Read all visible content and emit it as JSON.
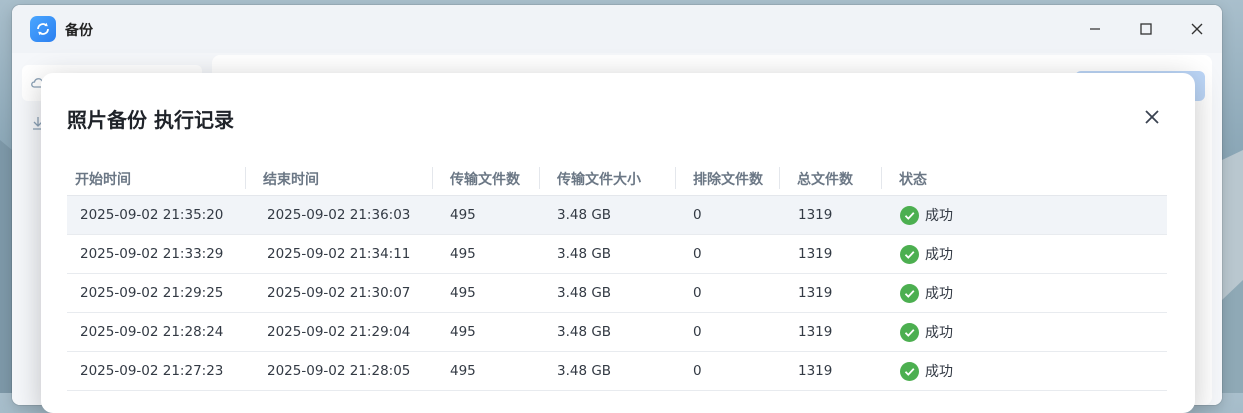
{
  "window": {
    "title": "备份",
    "app_icon": "sync-icon"
  },
  "modal": {
    "title": "照片备份 执行记录",
    "columns": [
      "开始时间",
      "结束时间",
      "传输文件数",
      "传输文件大小",
      "排除文件数",
      "总文件数",
      "状态"
    ],
    "rows": [
      {
        "start": "2025-09-02 21:35:20",
        "end": "2025-09-02 21:36:03",
        "transferred": "495",
        "size": "3.48 GB",
        "excluded": "0",
        "total": "1319",
        "status": "成功"
      },
      {
        "start": "2025-09-02 21:33:29",
        "end": "2025-09-02 21:34:11",
        "transferred": "495",
        "size": "3.48 GB",
        "excluded": "0",
        "total": "1319",
        "status": "成功"
      },
      {
        "start": "2025-09-02 21:29:25",
        "end": "2025-09-02 21:30:07",
        "transferred": "495",
        "size": "3.48 GB",
        "excluded": "0",
        "total": "1319",
        "status": "成功"
      },
      {
        "start": "2025-09-02 21:28:24",
        "end": "2025-09-02 21:29:04",
        "transferred": "495",
        "size": "3.48 GB",
        "excluded": "0",
        "total": "1319",
        "status": "成功"
      },
      {
        "start": "2025-09-02 21:27:23",
        "end": "2025-09-02 21:28:05",
        "transferred": "495",
        "size": "3.48 GB",
        "excluded": "0",
        "total": "1319",
        "status": "成功"
      }
    ]
  },
  "colors": {
    "success": "#4caf50",
    "accent": "#2b7ff0"
  }
}
